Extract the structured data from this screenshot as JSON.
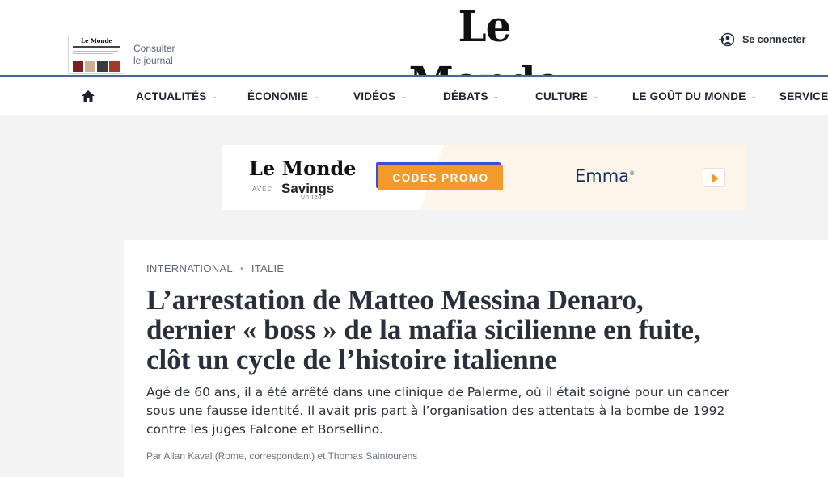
{
  "header": {
    "logo": "Le Monde",
    "thumbnail_logo": "Le Monde",
    "consult_line1": "Consulter",
    "consult_line2": "le journal",
    "login_label": "Se connecter",
    "login_icon": "user-login-icon"
  },
  "nav": {
    "home_icon": "home-icon",
    "items": [
      {
        "label": "ACTUALITÉS",
        "has_dropdown": true
      },
      {
        "label": "ÉCONOMIE",
        "has_dropdown": true
      },
      {
        "label": "VIDÉOS",
        "has_dropdown": true
      },
      {
        "label": "DÉBATS",
        "has_dropdown": true
      },
      {
        "label": "CULTURE",
        "has_dropdown": true
      },
      {
        "label": "LE GOÛT DU MONDE",
        "has_dropdown": true
      },
      {
        "label": "SERVICES",
        "has_dropdown": false
      }
    ],
    "chevron": "⌄"
  },
  "ad": {
    "logo": "Le Monde",
    "avec": "AVEC",
    "partner": "Savings",
    "partner_sub": "United",
    "cta": "CODES PROMO",
    "brand": "Emma",
    "brand_mark": "®",
    "colors": {
      "cta": "#f39b2a",
      "cta_shadow": "#3a4fd4",
      "brand": "#17315f"
    }
  },
  "article": {
    "breadcrumb": [
      "INTERNATIONAL",
      "ITALIE"
    ],
    "breadcrumb_sep": "•",
    "title_lines": [
      "L’arrestation de Matteo Messina Denaro,",
      "dernier « boss » de la mafia sicilienne en fuite,",
      "clôt un cycle de l’histoire italienne"
    ],
    "lead_lines": [
      "Agé de 60 ans, il a été arrêté dans une clinique de Palerme, où il était soigné pour un cancer",
      "sous une fausse identité. Il avait pris part à l’organisation des attentats à la bombe de 1992",
      "contre les juges Falcone et Borsellino."
    ],
    "byline": "Par Allan Kaval (Rome, correspondant) et Thomas Saintourens"
  },
  "colors": {
    "accent_rule": "#3f6a96",
    "text": "#2a303b",
    "background": "#f3f3f3"
  }
}
